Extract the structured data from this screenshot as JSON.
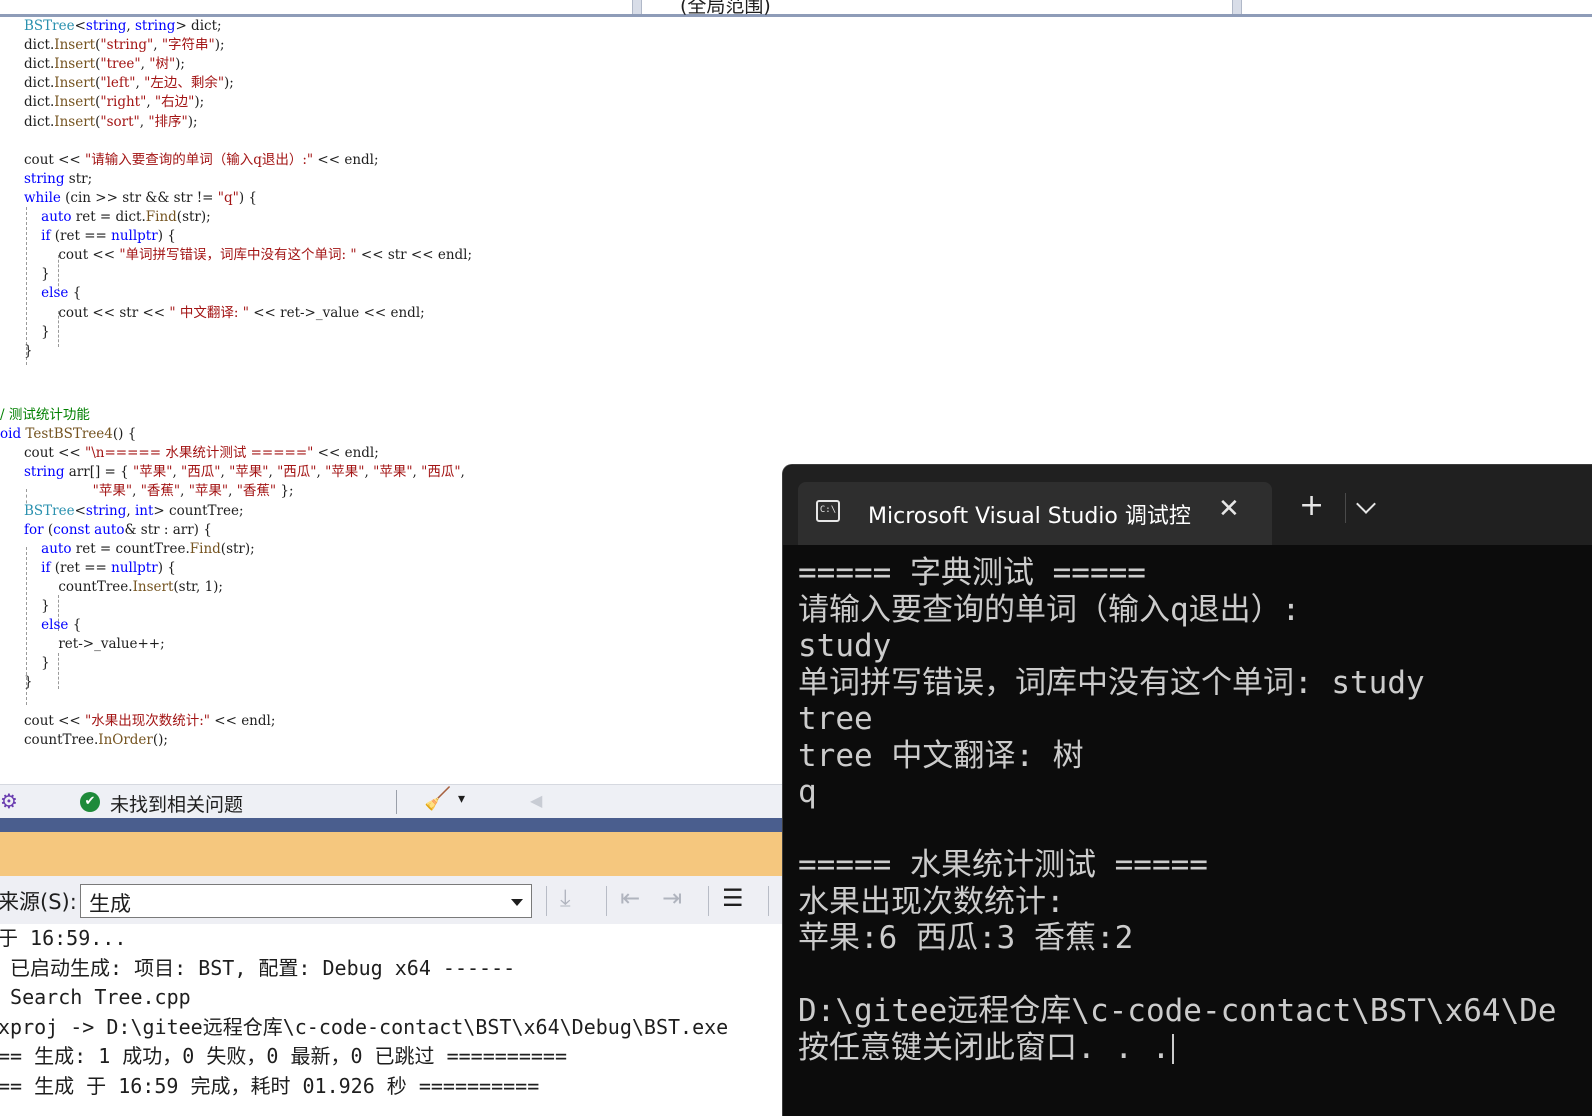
{
  "header": {
    "scope_label": "(全局范围)"
  },
  "code": [
    [
      [
        "t",
        "BSTree"
      ],
      [
        "p",
        "<"
      ],
      [
        "k",
        "string"
      ],
      [
        "p",
        ", "
      ],
      [
        "k",
        "string"
      ],
      [
        "p",
        "> dict;"
      ]
    ],
    [
      [
        "p",
        "dict."
      ],
      [
        "f",
        "Insert"
      ],
      [
        "p",
        "("
      ],
      [
        "s",
        "\"string\""
      ],
      [
        "p",
        ", "
      ],
      [
        "s",
        "\"字符串\""
      ],
      [
        "p",
        ");"
      ]
    ],
    [
      [
        "p",
        "dict."
      ],
      [
        "f",
        "Insert"
      ],
      [
        "p",
        "("
      ],
      [
        "s",
        "\"tree\""
      ],
      [
        "p",
        ", "
      ],
      [
        "s",
        "\"树\""
      ],
      [
        "p",
        ");"
      ]
    ],
    [
      [
        "p",
        "dict."
      ],
      [
        "f",
        "Insert"
      ],
      [
        "p",
        "("
      ],
      [
        "s",
        "\"left\""
      ],
      [
        "p",
        ", "
      ],
      [
        "s",
        "\"左边、剩余\""
      ],
      [
        "p",
        ");"
      ]
    ],
    [
      [
        "p",
        "dict."
      ],
      [
        "f",
        "Insert"
      ],
      [
        "p",
        "("
      ],
      [
        "s",
        "\"right\""
      ],
      [
        "p",
        ", "
      ],
      [
        "s",
        "\"右边\""
      ],
      [
        "p",
        ");"
      ]
    ],
    [
      [
        "p",
        "dict."
      ],
      [
        "f",
        "Insert"
      ],
      [
        "p",
        "("
      ],
      [
        "s",
        "\"sort\""
      ],
      [
        "p",
        ", "
      ],
      [
        "s",
        "\"排序\""
      ],
      [
        "p",
        ");"
      ]
    ],
    [],
    [
      [
        "p",
        "cout "
      ],
      [
        "p",
        "<< "
      ],
      [
        "s",
        "\"请输入要查询的单词（输入q退出）:\""
      ],
      [
        "p",
        " << endl;"
      ]
    ],
    [
      [
        "k",
        "string"
      ],
      [
        "p",
        " str;"
      ]
    ],
    [
      [
        "k",
        "while"
      ],
      [
        "p",
        " (cin >> str && str != "
      ],
      [
        "s",
        "\"q\""
      ],
      [
        "p",
        ") {"
      ]
    ],
    [
      [
        "p",
        "    "
      ],
      [
        "k",
        "auto"
      ],
      [
        "p",
        " ret = dict."
      ],
      [
        "f",
        "Find"
      ],
      [
        "p",
        "(str);"
      ]
    ],
    [
      [
        "p",
        "    "
      ],
      [
        "k",
        "if"
      ],
      [
        "p",
        " (ret == "
      ],
      [
        "k",
        "nullptr"
      ],
      [
        "p",
        ") {"
      ]
    ],
    [
      [
        "p",
        "        cout << "
      ],
      [
        "s",
        "\"单词拼写错误，词库中没有这个单词: \""
      ],
      [
        "p",
        " << str << endl;"
      ]
    ],
    [
      [
        "p",
        "    }"
      ]
    ],
    [
      [
        "p",
        "    "
      ],
      [
        "k",
        "else"
      ],
      [
        "p",
        " {"
      ]
    ],
    [
      [
        "p",
        "        cout << str << "
      ],
      [
        "s",
        "\" 中文翻译: \""
      ],
      [
        "p",
        " << ret->_value << endl;"
      ]
    ],
    [
      [
        "p",
        "    }"
      ]
    ],
    [
      [
        "p",
        "}"
      ]
    ],
    [],
    [],
    [
      [
        "c",
        "/ 测试统计功能"
      ]
    ],
    [
      [
        "k",
        "oid"
      ],
      [
        "p",
        " "
      ],
      [
        "f",
        "TestBSTree4"
      ],
      [
        "p",
        "() {"
      ]
    ],
    [
      [
        "p",
        "cout << "
      ],
      [
        "s",
        "\"\\n===== 水果统计测试 =====\""
      ],
      [
        "p",
        " << endl;"
      ]
    ],
    [
      [
        "k",
        "string"
      ],
      [
        "p",
        " arr[] = { "
      ],
      [
        "s",
        "\"苹果\""
      ],
      [
        "p",
        ", "
      ],
      [
        "s",
        "\"西瓜\""
      ],
      [
        "p",
        ", "
      ],
      [
        "s",
        "\"苹果\""
      ],
      [
        "p",
        ", "
      ],
      [
        "s",
        "\"西瓜\""
      ],
      [
        "p",
        ", "
      ],
      [
        "s",
        "\"苹果\""
      ],
      [
        "p",
        ", "
      ],
      [
        "s",
        "\"苹果\""
      ],
      [
        "p",
        ", "
      ],
      [
        "s",
        "\"西瓜\""
      ],
      [
        "p",
        ","
      ]
    ],
    [
      [
        "p",
        "                "
      ],
      [
        "s",
        "\"苹果\""
      ],
      [
        "p",
        ", "
      ],
      [
        "s",
        "\"香蕉\""
      ],
      [
        "p",
        ", "
      ],
      [
        "s",
        "\"苹果\""
      ],
      [
        "p",
        ", "
      ],
      [
        "s",
        "\"香蕉\""
      ],
      [
        "p",
        " };"
      ]
    ],
    [
      [
        "t",
        "BSTree"
      ],
      [
        "p",
        "<"
      ],
      [
        "k",
        "string"
      ],
      [
        "p",
        ", "
      ],
      [
        "k",
        "int"
      ],
      [
        "p",
        "> countTree;"
      ]
    ],
    [
      [
        "k",
        "for"
      ],
      [
        "p",
        " ("
      ],
      [
        "k",
        "const auto"
      ],
      [
        "p",
        "& str : arr) {"
      ]
    ],
    [
      [
        "p",
        "    "
      ],
      [
        "k",
        "auto"
      ],
      [
        "p",
        " ret = countTree."
      ],
      [
        "f",
        "Find"
      ],
      [
        "p",
        "(str);"
      ]
    ],
    [
      [
        "p",
        "    "
      ],
      [
        "k",
        "if"
      ],
      [
        "p",
        " (ret == "
      ],
      [
        "k",
        "nullptr"
      ],
      [
        "p",
        ") {"
      ]
    ],
    [
      [
        "p",
        "        countTree."
      ],
      [
        "f",
        "Insert"
      ],
      [
        "p",
        "(str, 1);"
      ]
    ],
    [
      [
        "p",
        "    }"
      ]
    ],
    [
      [
        "p",
        "    "
      ],
      [
        "k",
        "else"
      ],
      [
        "p",
        " {"
      ]
    ],
    [
      [
        "p",
        "        ret->_value++;"
      ]
    ],
    [
      [
        "p",
        "    }"
      ]
    ],
    [
      [
        "p",
        "}"
      ]
    ],
    [],
    [
      [
        "p",
        "cout << "
      ],
      [
        "s",
        "\"水果出现次数统计:\""
      ],
      [
        "p",
        " << endl;"
      ]
    ],
    [
      [
        "p",
        "countTree."
      ],
      [
        "f",
        "InOrder"
      ],
      [
        "p",
        "();"
      ]
    ]
  ],
  "status": {
    "issues_text": "未找到相关问题",
    "ok_icon": "✔",
    "brush_icon": "🧹",
    "dropdown_icon": "▾",
    "arrow_icon": "◀",
    "spy_icon": "⚙"
  },
  "output": {
    "source_label": "来源(S):",
    "source_value": "生成",
    "lines": [
      "于 16:59...",
      " 已启动生成: 项目: BST, 配置: Debug x64 ------",
      " Search Tree.cpp",
      "xproj -> D:\\gitee远程仓库\\c-code-contact\\BST\\x64\\Debug\\BST.exe",
      "== 生成: 1 成功，0 失败，0 最新，0 已跳过 ==========",
      "== 生成 于 16:59 完成，耗时 01.926 秒 =========="
    ]
  },
  "terminal": {
    "tab_icon_text": "C:\\",
    "tab_title": "Microsoft Visual Studio 调试控",
    "close_icon": "✕",
    "plus_icon": "+",
    "lines": [
      "===== 字典测试 =====",
      "请输入要查询的单词（输入q退出）:",
      "study",
      "单词拼写错误，词库中没有这个单词: study",
      "tree",
      "tree 中文翻译: 树",
      "q",
      "",
      "===== 水果统计测试 =====",
      "水果出现次数统计:",
      "苹果:6 西瓜:3 香蕉:2",
      "",
      "D:\\gitee远程仓库\\c-code-contact\\BST\\x64\\De",
      "按任意键关闭此窗口. . ."
    ]
  },
  "colors": {
    "keyword": "#0000ff",
    "type": "#2b91af",
    "string": "#a31515",
    "comment": "#008000",
    "terminal_bg": "#0c0c0c",
    "orange_band": "#f5c77e"
  }
}
